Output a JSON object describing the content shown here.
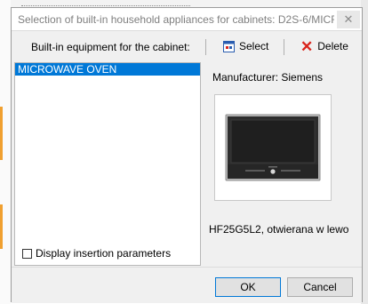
{
  "window": {
    "title": "Selection of built-in household appliances for cabinets: D2S-6/MICRO...",
    "close_glyph": "✕"
  },
  "toolbar": {
    "equipment_label": "Built-in equipment for the cabinet:",
    "select_label": "Select",
    "delete_label": "Delete",
    "select_icon": "select-icon",
    "delete_icon": "delete-icon"
  },
  "list": {
    "items": [
      "MICROWAVE OVEN"
    ],
    "selected_index": 0
  },
  "details": {
    "manufacturer": "Manufacturer: Siemens",
    "model": "HF25G5L2, otwierana w lewo"
  },
  "options": {
    "display_insertion_label": "Display insertion parameters",
    "display_insertion_checked": false
  },
  "buttons": {
    "ok": "OK",
    "cancel": "Cancel"
  },
  "colors": {
    "selection": "#0078d7",
    "delete_icon": "#d9231b",
    "dialog_bg": "#f0f0f0"
  }
}
